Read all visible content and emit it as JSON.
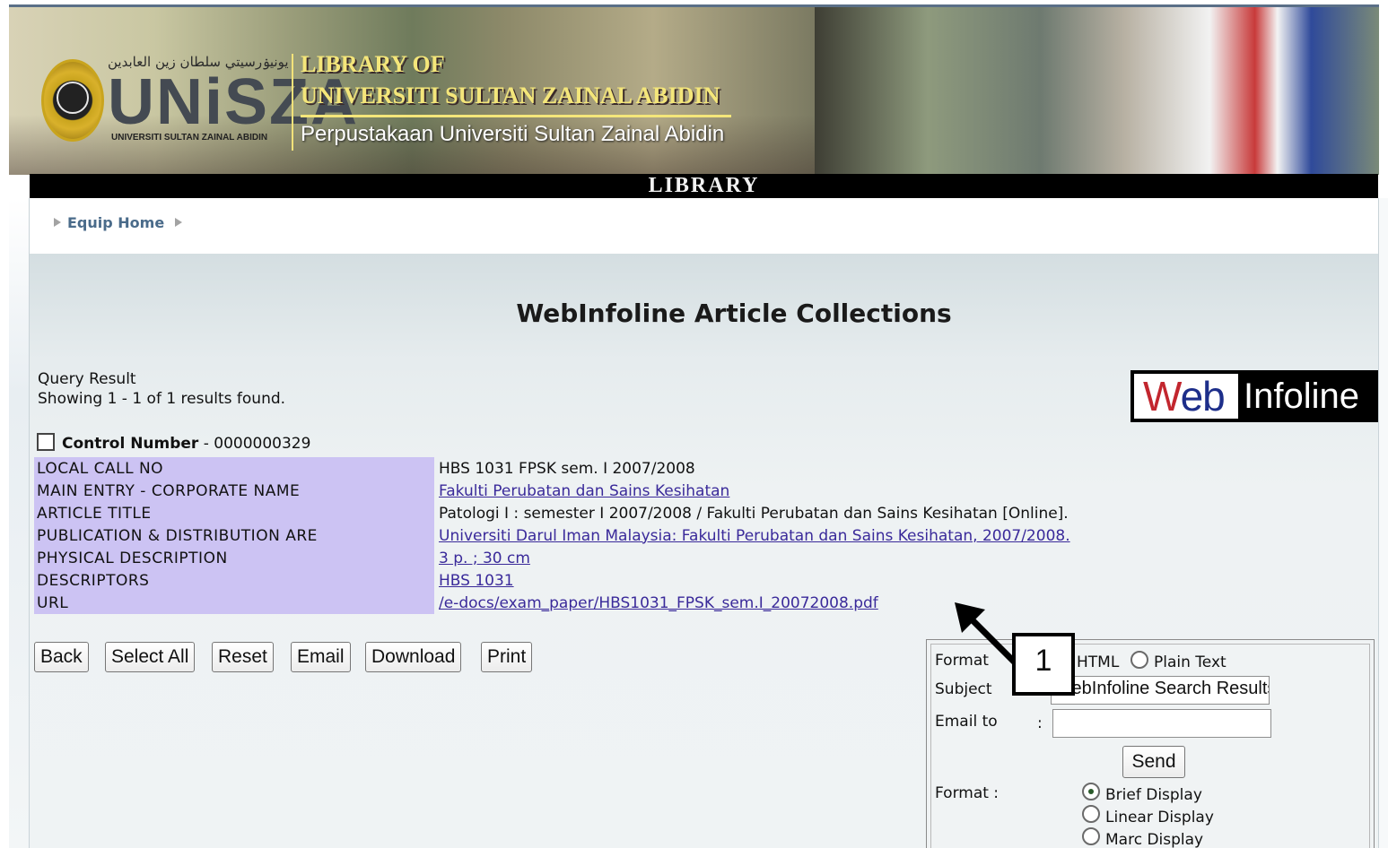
{
  "banner": {
    "arabic_text": "يونيۏرسيتي سلطان زين العابدين",
    "logo_text": "UNiSZA",
    "logo_subtext": "UNIVERSITI SULTAN ZAINAL ABIDIN",
    "title_line1": "LIBRARY OF",
    "title_line2": "UNIVERSITI SULTAN ZAINAL ABIDIN",
    "title_line3": "Perpustakaan Universiti Sultan Zainal Abidin",
    "bar_label": "LIBRARY"
  },
  "breadcrumb": {
    "home_label": "Equip Home"
  },
  "page": {
    "title": "WebInfoline Article Collections",
    "query_label": "Query Result",
    "query_count": "Showing 1 - 1 of 1 results found."
  },
  "logo": {
    "web": "Web",
    "infoline": "Infoline"
  },
  "record": {
    "control_label": "Control Number",
    "control_value": " - 0000000329",
    "rows": [
      {
        "label": "LOCAL CALL NO",
        "value": "HBS 1031 FPSK sem. I 2007/2008",
        "link": false
      },
      {
        "label": "MAIN ENTRY - CORPORATE NAME",
        "value": "Fakulti Perubatan dan Sains Kesihatan",
        "link": true
      },
      {
        "label": "ARTICLE TITLE",
        "value": "Patologi I : semester I 2007/2008 / Fakulti Perubatan dan Sains Kesihatan [Online].",
        "link": false
      },
      {
        "label": "PUBLICATION & DISTRIBUTION ARE",
        "value": "Universiti Darul Iman Malaysia: Fakulti Perubatan dan Sains Kesihatan, 2007/2008.",
        "link": true
      },
      {
        "label": "PHYSICAL DESCRIPTION",
        "value": "3 p. ; 30 cm",
        "link": true
      },
      {
        "label": "DESCRIPTORS",
        "value": "HBS 1031",
        "link": true
      },
      {
        "label": "URL",
        "value": "/e-docs/exam_paper/HBS1031_FPSK_sem.I_20072008.pdf",
        "link": true
      }
    ]
  },
  "buttons": {
    "back": "Back",
    "select_all": "Select All",
    "reset": "Reset",
    "email": "Email",
    "download": "Download",
    "print": "Print"
  },
  "email_panel": {
    "format_label": "Format",
    "format_html": "HTML",
    "format_plain": "Plain Text",
    "subject_label": "Subject",
    "subject_value": "WebInfoline Search Results",
    "email_label": "Email to",
    "email_colon": ":",
    "email_value": "",
    "send_label": "Send",
    "display_label": "Format :",
    "display_options": [
      "Brief Display",
      "Linear Display",
      "Marc Display"
    ],
    "display_selected": "Brief Display"
  },
  "annotation": {
    "number": "1"
  }
}
